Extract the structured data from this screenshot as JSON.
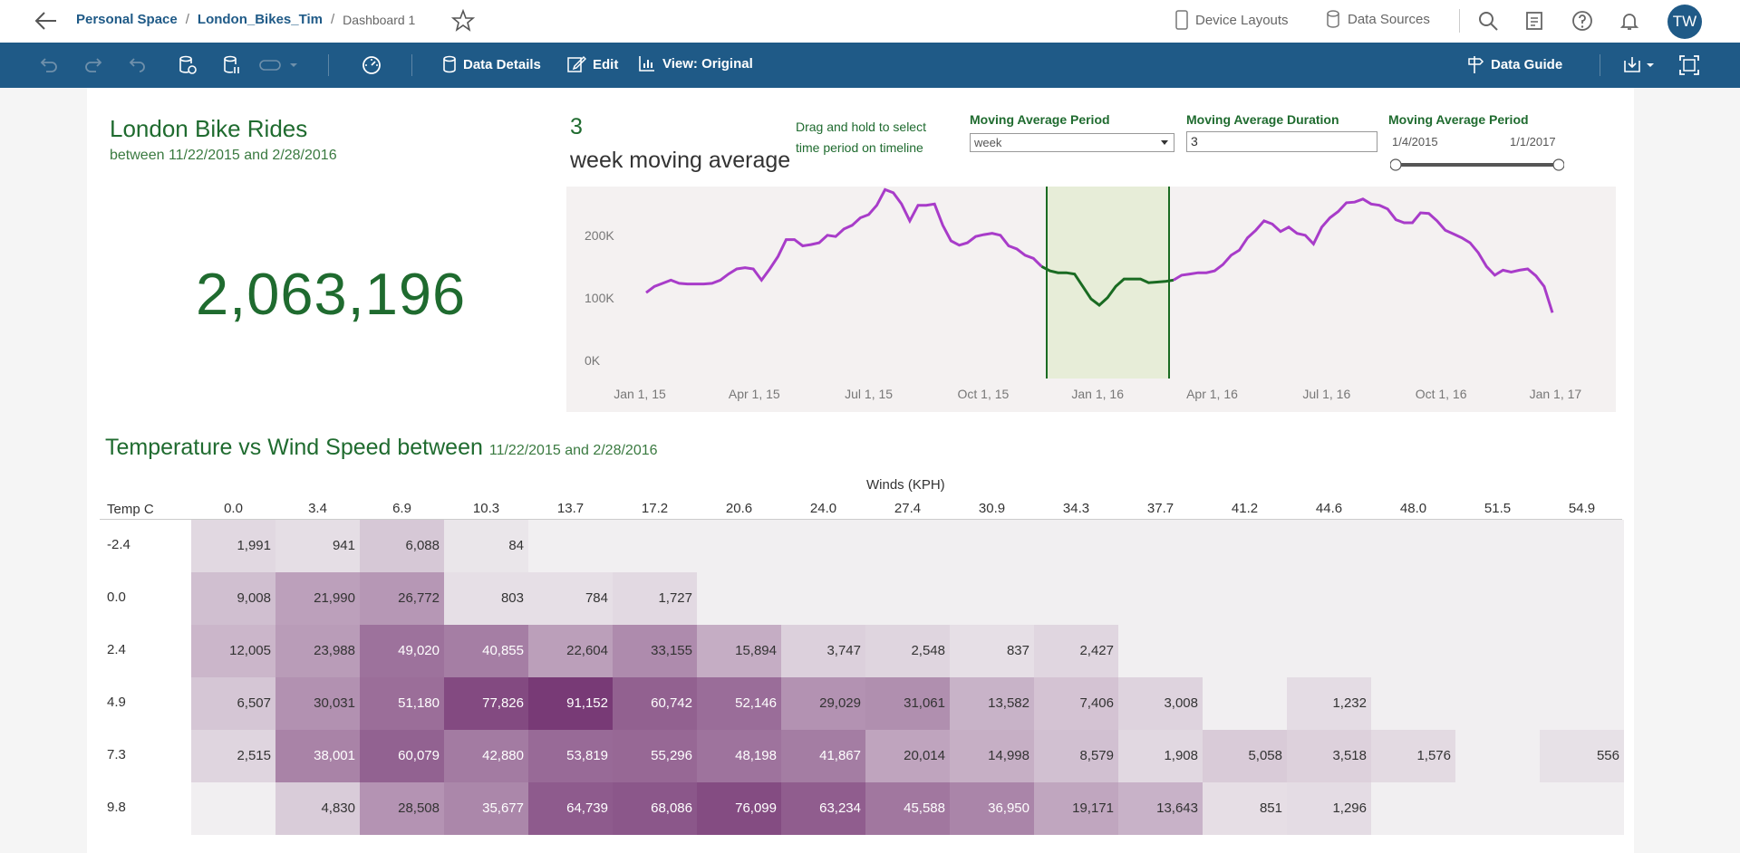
{
  "breadcrumb": {
    "space": "Personal Space",
    "workbook": "London_Bikes_Tim",
    "dashboard": "Dashboard 1"
  },
  "topbar": {
    "device_layouts": "Device Layouts",
    "data_sources": "Data Sources",
    "avatar_initials": "TW"
  },
  "toolbar": {
    "data_details": "Data Details",
    "edit": "Edit",
    "view": "View: Original",
    "data_guide": "Data Guide"
  },
  "kpi": {
    "title": "London Bike Rides",
    "subtitle": "between 11/22/2015 and 2/28/2016",
    "value": "2,063,196"
  },
  "moving_average": {
    "number": "3",
    "label": "week moving average",
    "drag_note": "Drag and hold to select time period on timeline",
    "period_label": "Moving Average Period",
    "period_value": "week",
    "duration_label": "Moving Average Duration",
    "duration_value": "3",
    "range_label": "Moving Average Period",
    "range_start": "1/4/2015",
    "range_end": "1/1/2017"
  },
  "colors": {
    "accent": "#1f5a87",
    "title_green": "#1f6b2f",
    "line_purple": "#a83cc9",
    "line_green": "#1a6b22",
    "highlight": "#e7edd8"
  },
  "chart_data": {
    "type": "line",
    "x_ticks": [
      "Jan 1, 15",
      "Apr 1, 15",
      "Jul 1, 15",
      "Oct 1, 15",
      "Jan 1, 16",
      "Apr 1, 16",
      "Jul 1, 16",
      "Oct 1, 16",
      "Jan 1, 17"
    ],
    "y_ticks": [
      "0K",
      "100K",
      "200K"
    ],
    "ylim": [
      0,
      290000
    ],
    "highlight_range": [
      "Nov 22, 15",
      "Feb 28, 16"
    ],
    "series": [
      {
        "values": [
          120000,
          130000,
          135000,
          140000,
          135000,
          134000,
          134000,
          134000,
          135000,
          140000,
          150000,
          158000,
          160000,
          158000,
          140000,
          158000,
          178000,
          205000,
          205000,
          195000,
          197000,
          200000,
          212000,
          210000,
          222000,
          228000,
          240000,
          245000,
          260000,
          285000,
          280000,
          262000,
          235000,
          260000,
          260000,
          262000,
          228000,
          203000,
          196000,
          200000,
          210000,
          213000,
          215000,
          212000,
          195000,
          190000,
          180000,
          175000,
          162000,
          155000,
          152000,
          152000,
          150000,
          130000,
          110000,
          100000,
          112000,
          130000,
          142000,
          142000,
          142000,
          136000,
          137000,
          138000,
          140000,
          148000,
          150000,
          152000,
          152000,
          155000,
          165000,
          180000,
          188000,
          208000,
          220000,
          235000,
          230000,
          218000,
          225000,
          215000,
          212000,
          198000,
          225000,
          240000,
          250000,
          264000,
          265000,
          270000,
          262000,
          260000,
          254000,
          237000,
          232000,
          232000,
          248000,
          247000,
          235000,
          220000,
          214000,
          208000,
          200000,
          184000,
          162000,
          148000,
          156000,
          153000,
          156000,
          158000,
          147000,
          130000,
          88000
        ]
      }
    ]
  },
  "heatmap": {
    "title": "Temperature vs Wind Speed between",
    "subtitle": "11/22/2015 and 2/28/2016",
    "col_axis": "Winds (KPH)",
    "row_axis": "Temp C",
    "columns": [
      "0.0",
      "3.4",
      "6.9",
      "10.3",
      "13.7",
      "17.2",
      "20.6",
      "24.0",
      "27.4",
      "30.9",
      "34.3",
      "37.7",
      "41.2",
      "44.6",
      "48.0",
      "51.5",
      "54.9"
    ],
    "rows": [
      {
        "label": "-2.4",
        "cells": [
          "1,991",
          "941",
          "6,088",
          "84",
          "",
          "",
          "",
          "",
          "",
          "",
          "",
          "",
          "",
          "",
          "",
          "",
          ""
        ]
      },
      {
        "label": "0.0",
        "cells": [
          "9,008",
          "21,990",
          "26,772",
          "803",
          "784",
          "1,727",
          "",
          "",
          "",
          "",
          "",
          "",
          "",
          "",
          "",
          "",
          ""
        ]
      },
      {
        "label": "2.4",
        "cells": [
          "12,005",
          "23,988",
          "49,020",
          "40,855",
          "22,604",
          "33,155",
          "15,894",
          "3,747",
          "2,548",
          "837",
          "2,427",
          "",
          "",
          "",
          "",
          "",
          ""
        ]
      },
      {
        "label": "4.9",
        "cells": [
          "6,507",
          "30,031",
          "51,180",
          "77,826",
          "91,152",
          "60,742",
          "52,146",
          "29,029",
          "31,061",
          "13,582",
          "7,406",
          "3,008",
          "",
          "1,232",
          "",
          "",
          ""
        ]
      },
      {
        "label": "7.3",
        "cells": [
          "2,515",
          "38,001",
          "60,079",
          "42,880",
          "53,819",
          "55,296",
          "48,198",
          "41,867",
          "20,014",
          "14,998",
          "8,579",
          "1,908",
          "5,058",
          "3,518",
          "1,576",
          "",
          "556"
        ]
      },
      {
        "label": "9.8",
        "cells": [
          "",
          "4,830",
          "28,508",
          "35,677",
          "64,739",
          "68,086",
          "76,099",
          "63,234",
          "45,588",
          "36,950",
          "19,171",
          "13,643",
          "851",
          "1,296",
          "",
          "",
          ""
        ]
      }
    ]
  }
}
